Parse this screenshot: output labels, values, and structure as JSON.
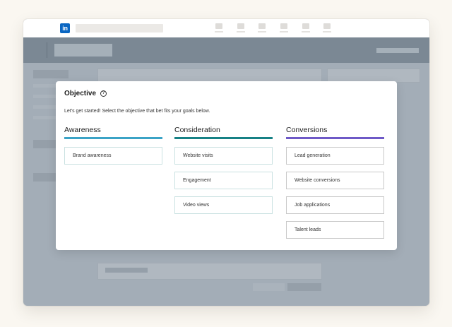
{
  "topnav": {
    "logo_text": "in",
    "nav_icons": [
      "nav-icon-1",
      "nav-icon-2",
      "nav-icon-3",
      "nav-icon-4",
      "nav-icon-5",
      "nav-icon-6"
    ]
  },
  "modal": {
    "title": "Objective",
    "help_icon_glyph": "?",
    "subtitle": "Let's get started! Select the objective that bet fits your goals below.",
    "columns": [
      {
        "heading": "Awareness",
        "accent": "#3ba3c6",
        "options": [
          "Brand awareness"
        ]
      },
      {
        "heading": "Consideration",
        "accent": "#168185",
        "options": [
          "Website visits",
          "Engagement",
          "Video views"
        ]
      },
      {
        "heading": "Conversions",
        "accent": "#6e59c7",
        "options": [
          "Lead generation",
          "Website conversions",
          "Job applications",
          "Talent leads"
        ]
      }
    ]
  },
  "colors": {
    "brand": "#0a66c2",
    "overlay": "#a3adb7",
    "secondary_bar": "#7b8894"
  }
}
